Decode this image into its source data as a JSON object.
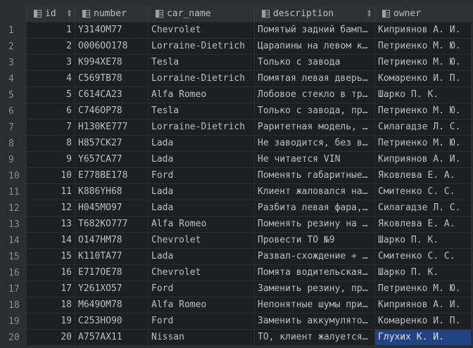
{
  "columns": [
    {
      "key": "id",
      "label": "id"
    },
    {
      "key": "number",
      "label": "number"
    },
    {
      "key": "car_name",
      "label": "car_name"
    },
    {
      "key": "description",
      "label": "description"
    },
    {
      "key": "owner",
      "label": "owner"
    }
  ],
  "rows": [
    {
      "n": "1",
      "id": "1",
      "number": "Y314OM77",
      "car_name": "Chevrolet",
      "description": "Помятый задний бамп…",
      "owner": "Киприянов А. И."
    },
    {
      "n": "2",
      "id": "2",
      "number": "O006OO178",
      "car_name": "Lorraine-Dietrich",
      "description": "Царапины на левом к…",
      "owner": "Петриенко М. Ю."
    },
    {
      "n": "3",
      "id": "3",
      "number": "K994XE78",
      "car_name": "Tesla",
      "description": "Только с завода",
      "owner": "Петриенко М. Ю."
    },
    {
      "n": "4",
      "id": "4",
      "number": "C569TB78",
      "car_name": "Lorraine-Dietrich",
      "description": "Помятая левая дверь…",
      "owner": "Комаренко И. П."
    },
    {
      "n": "5",
      "id": "5",
      "number": "C614CA23",
      "car_name": "Alfa Romeo",
      "description": "Лобовое стекло в тр…",
      "owner": "Шарко П. К."
    },
    {
      "n": "6",
      "id": "6",
      "number": "C746OP78",
      "car_name": "Tesla",
      "description": "Только с завода, пр…",
      "owner": "Петриенко М. Ю."
    },
    {
      "n": "7",
      "id": "7",
      "number": "H130KE777",
      "car_name": "Lorraine-Dietrich",
      "description": "Раритетная модель, …",
      "owner": "Силагадзе Л. С."
    },
    {
      "n": "8",
      "id": "8",
      "number": "H857CK27",
      "car_name": "Lada",
      "description": "Не заводится, без в…",
      "owner": "Петриенко М. Ю."
    },
    {
      "n": "9",
      "id": "9",
      "number": "Y657CA77",
      "car_name": "Lada",
      "description": "Не читается VIN",
      "owner": "Киприянов А. И."
    },
    {
      "n": "10",
      "id": "10",
      "number": "E778BE178",
      "car_name": "Ford",
      "description": "Поменять габаритные…",
      "owner": "Яковлева Е. А."
    },
    {
      "n": "11",
      "id": "11",
      "number": "K886YH68",
      "car_name": "Lada",
      "description": "Клиент жаловался на…",
      "owner": "Смитенко С. С."
    },
    {
      "n": "12",
      "id": "12",
      "number": "H045MO97",
      "car_name": "Lada",
      "description": "Разбита левая фара,…",
      "owner": "Силагадзе Л. С."
    },
    {
      "n": "13",
      "id": "13",
      "number": "T682KO777",
      "car_name": "Alfa Romeo",
      "description": "Поменять резину на …",
      "owner": "Яковлева Е. А."
    },
    {
      "n": "14",
      "id": "14",
      "number": "O147HM78",
      "car_name": "Chevrolet",
      "description": "Провести ТО №9",
      "owner": "Шарко П. К."
    },
    {
      "n": "15",
      "id": "15",
      "number": "K110TA77",
      "car_name": "Lada",
      "description": "Развал-схождение + …",
      "owner": "Смитенко С. С."
    },
    {
      "n": "16",
      "id": "16",
      "number": "E717OE78",
      "car_name": "Chevrolet",
      "description": "Помята водительская…",
      "owner": "Шарко П. К."
    },
    {
      "n": "17",
      "id": "17",
      "number": "Y261XO57",
      "car_name": "Ford",
      "description": "Заменить резину, пр…",
      "owner": "Петриенко М. Ю."
    },
    {
      "n": "18",
      "id": "18",
      "number": "M649OM78",
      "car_name": "Alfa Romeo",
      "description": "Непонятные шумы при…",
      "owner": "Киприянов А. И."
    },
    {
      "n": "19",
      "id": "19",
      "number": "C253HO90",
      "car_name": "Ford",
      "description": "Заменить аккумулято…",
      "owner": "Комаренко И. П."
    },
    {
      "n": "20",
      "id": "20",
      "number": "A757AX11",
      "car_name": "Nissan",
      "description": "ТО, клиент жалуется…",
      "owner": "Глухих К. И."
    }
  ],
  "selected": {
    "row": 20,
    "column": "owner"
  },
  "colors": {
    "background": "#2b2d30",
    "cell": "#1e1f22",
    "selection": "#214283",
    "header": "#2f3134"
  },
  "icons": {
    "column": "table-column-icon",
    "sort": "sort-arrows-icon"
  }
}
